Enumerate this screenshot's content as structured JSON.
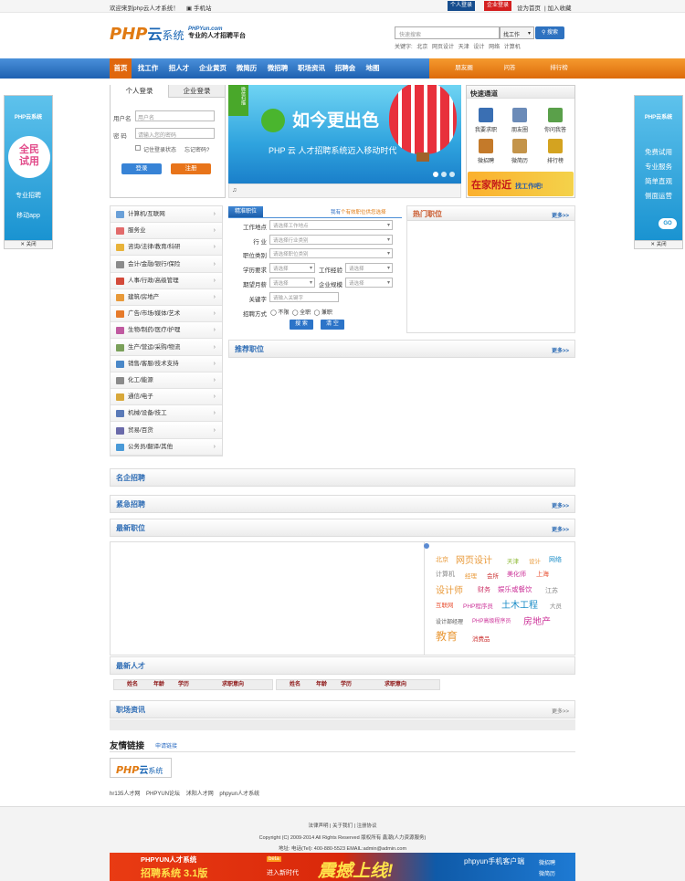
{
  "topbar": {
    "welcome": "欢迎来到php云人才系统！",
    "mobile": "手机站",
    "personal_login": "个人登录",
    "company_login": "企业登录",
    "links": [
      "设为首页",
      "加入收藏"
    ]
  },
  "header": {
    "logo_php": "PHP",
    "logo_cloud": "云",
    "logo_sys": "系统",
    "slogan_site": "PHPYun.com",
    "slogan_text": "专业的人才招聘平台",
    "search_placeholder": "快速搜索",
    "search_type": "找工作",
    "search_button": "搜索",
    "hot_label": "关键字:",
    "hot_keywords": [
      "北京",
      "网页设计",
      "天津",
      "设计",
      "网络",
      "计算机"
    ]
  },
  "nav": {
    "items": [
      "首页",
      "找工作",
      "招人才",
      "企业黄页",
      "微简历",
      "微招聘",
      "职场资讯",
      "招聘会",
      "地图"
    ],
    "sub": [
      "朋友圈",
      "问答",
      "排行榜"
    ]
  },
  "left_ad": {
    "brand": "PHP云系统",
    "big": [
      "全民",
      "试用"
    ],
    "lines": [
      "专业招聘",
      "移动app"
    ],
    "close": "关闭"
  },
  "right_ad": {
    "brand": "PHP云系统",
    "lines": [
      "免费试用",
      "专业服务",
      "简单直观",
      "侧面运营"
    ],
    "go": "GO",
    "close": "关闭"
  },
  "login": {
    "tab_personal": "个人登录",
    "tab_company": "企业登录",
    "user_label": "用户名",
    "user_placeholder": "用户名",
    "pwd_label": "密  码",
    "pwd_placeholder": "请输入您的密码",
    "remember": "记住登录状态",
    "forgot": "忘记密码?",
    "login_btn": "登录",
    "reg_btn": "注册"
  },
  "banner": {
    "tag": "微信扫描",
    "headline": "如今更出色",
    "sub": "PHP 云 人才招聘系统迈入移动时代"
  },
  "quick": {
    "title": "快速通道",
    "items": [
      {
        "label": "我要求职",
        "color": "#3a6fb3"
      },
      {
        "label": "朋友圈",
        "color": "#6b8bb8"
      },
      {
        "label": "你问我答",
        "color": "#5aa04a"
      },
      {
        "label": "微招聘",
        "color": "#c47a2a"
      },
      {
        "label": "微简历",
        "color": "#c4944a"
      },
      {
        "label": "排行榜",
        "color": "#d4a320"
      }
    ],
    "ad_text": "在家附近",
    "ad_sub": "找工作吧!"
  },
  "categories": [
    {
      "label": "计算机/互联网",
      "color": "#6aa0d8"
    },
    {
      "label": "服务业",
      "color": "#e26b6b"
    },
    {
      "label": "咨询/法律/教育/科研",
      "color": "#e8b33a"
    },
    {
      "label": "会计/金融/银行/保险",
      "color": "#8b8b8b"
    },
    {
      "label": "人事/行政/高级管理",
      "color": "#d34a3a"
    },
    {
      "label": "建筑/房地产",
      "color": "#e89a3a"
    },
    {
      "label": "广告/市场/媒体/艺术",
      "color": "#e67a2a"
    },
    {
      "label": "生物/制药/医疗/护理",
      "color": "#c05aa0"
    },
    {
      "label": "生产/营运/采购/物流",
      "color": "#7aa05a"
    },
    {
      "label": "销售/客服/技术支持",
      "color": "#4a88c8"
    },
    {
      "label": "化工/能源",
      "color": "#8a8a8a"
    },
    {
      "label": "通信/电子",
      "color": "#d8a83a"
    },
    {
      "label": "机械/设备/技工",
      "color": "#5a7ab8"
    },
    {
      "label": "贸易/百货",
      "color": "#6a6aaa"
    },
    {
      "label": "公务员/翻译/其他",
      "color": "#4a9ad8"
    }
  ],
  "search_form": {
    "tab": "精准职位",
    "link1": "我有",
    "link2": "个有效职位供您选择",
    "fields": {
      "place_label": "工作地点",
      "place_ph": "请选择工作地点",
      "industry_label": "行    业",
      "industry_ph": "请选择行业类别",
      "category_label": "职位类别",
      "category_ph": "请选择职位类别",
      "edu_label": "学历要求",
      "edu_ph": "请选择",
      "exp_label": "工作经验",
      "exp_ph": "请选择",
      "salary_label": "期望月薪",
      "salary_ph": "请选择",
      "scale_label": "企业规模",
      "scale_ph": "请选择",
      "keyword_label": "关键字",
      "keyword_ph": "请输入关键字",
      "type_label": "招聘方式",
      "types": [
        "不限",
        "全职",
        "兼职"
      ]
    },
    "search_btn": "搜 索",
    "clear_btn": "清 空"
  },
  "sections": {
    "hot_jobs": "热门职位",
    "recommend": "推荐职位",
    "famous": "名企招聘",
    "urgent": "紧急招聘",
    "latest_jobs": "最新职位",
    "latest_talents": "最新人才",
    "news": "职场资讯",
    "more": "更多>>"
  },
  "tag_cloud": [
    {
      "text": "北京",
      "color": "#e99a3a",
      "size": 7
    },
    {
      "text": "网页设计",
      "color": "#e99a3a",
      "size": 10
    },
    {
      "text": "天津",
      "color": "#8cb832",
      "size": 6.5
    },
    {
      "text": "设计",
      "color": "#e99a3a",
      "size": 6.5
    },
    {
      "text": "网络",
      "color": "#1a8cc7",
      "size": 7
    },
    {
      "text": "计算机",
      "color": "#888",
      "size": 7
    },
    {
      "text": "经理",
      "color": "#e99a3a",
      "size": 6.5
    },
    {
      "text": "会所",
      "color": "#cc3333",
      "size": 6.5
    },
    {
      "text": "美化师",
      "color": "#cc3399",
      "size": 7
    },
    {
      "text": "上海",
      "color": "#e9573a",
      "size": 7
    },
    {
      "text": "设计师",
      "color": "#e99a3a",
      "size": 10
    },
    {
      "text": "财务",
      "color": "#cc3366",
      "size": 7
    },
    {
      "text": "娱乐或餐饮",
      "color": "#cc3399",
      "size": 7.5
    },
    {
      "text": "江苏",
      "color": "#888",
      "size": 7
    },
    {
      "text": "互联网",
      "color": "#e9573a",
      "size": 6.5
    },
    {
      "text": "PHP程序员",
      "color": "#cc3399",
      "size": 6.5
    },
    {
      "text": "土木工程",
      "color": "#1a8cc7",
      "size": 10
    },
    {
      "text": "大员",
      "color": "#888",
      "size": 6.5
    },
    {
      "text": "设计部经理",
      "color": "#555",
      "size": 6
    },
    {
      "text": "PHP高级程序员",
      "color": "#cc3399",
      "size": 6
    },
    {
      "text": "房地产",
      "color": "#cc3399",
      "size": 10
    },
    {
      "text": "教育",
      "color": "#e99a3a",
      "size": 12
    },
    {
      "text": "消费品",
      "color": "#cc3333",
      "size": 6.5
    }
  ],
  "talents": {
    "headers": [
      "姓名",
      "年龄",
      "学历",
      "求职意向"
    ]
  },
  "friend_links": {
    "title": "友情链接",
    "apply": "申请链接",
    "text_links": [
      "hr135人才网",
      "PHPYUN论坛",
      "沭阳人才网",
      "phpyun人才系统"
    ]
  },
  "footer": {
    "links": [
      "法律声明",
      "关于我们",
      "注册协议"
    ],
    "copyright": "Copyright (C) 2009-2014 All Rights Reserved 版权所有 鑫潮(人力资源服务)",
    "contact": "地址: 电话(Tel): 400-880-5523 EMAIL:admin@admin.com",
    "ad_brand": "PHPYUN人才系统",
    "ad_version": "招聘系统 3.1版",
    "ad_beta": "beta",
    "ad_new": "进入新时代",
    "ad_slogan": "震撼上线!",
    "ad_mobile": "phpyun手机客户端",
    "ad_mobile_items": [
      "微招聘",
      "微简历"
    ]
  }
}
